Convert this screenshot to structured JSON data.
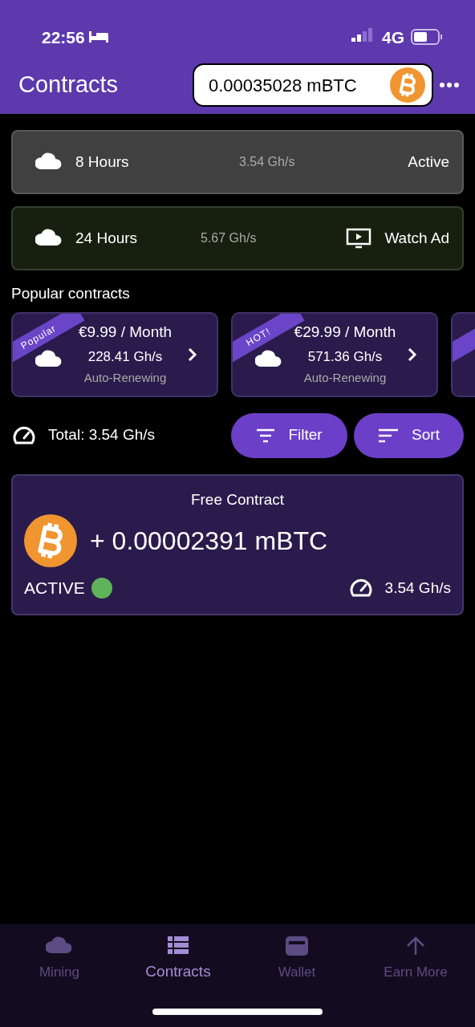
{
  "status_bar": {
    "time": "22:56",
    "network": "4G"
  },
  "header": {
    "title": "Contracts",
    "balance": "0.00035028 mBTC"
  },
  "active_contracts": [
    {
      "kind": "active",
      "duration": "8 Hours",
      "speed": "3.54 Gh/s",
      "status": "Active"
    },
    {
      "kind": "watch_ad",
      "duration": "24 Hours",
      "speed": "5.67 Gh/s",
      "status": "Watch Ad"
    }
  ],
  "popular": {
    "title": "Popular contracts",
    "items": [
      {
        "ribbon": "Popular",
        "price": "€9.99 / Month",
        "speed": "228.41 Gh/s",
        "renewal": "Auto-Renewing"
      },
      {
        "ribbon": "HOT!",
        "price": "€29.99 / Month",
        "speed": "571.36 Gh/s",
        "renewal": "Auto-Renewing"
      }
    ]
  },
  "total": "Total: 3.54 Gh/s",
  "buttons": [
    {
      "kind": "filter",
      "label": "Filter"
    },
    {
      "kind": "sort",
      "label": "Sort"
    }
  ],
  "free_contract": {
    "title": "Free Contract",
    "amount": "+ 0.00002391 mBTC",
    "status": "ACTIVE",
    "active": true,
    "speed": "3.54 Gh/s"
  },
  "tabs": [
    {
      "kind": "cloud",
      "label": "Mining",
      "selected": false
    },
    {
      "kind": "list",
      "label": "Contracts",
      "selected": true
    },
    {
      "kind": "wallet",
      "label": "Wallet",
      "selected": false
    },
    {
      "kind": "arrow",
      "label": "Earn More",
      "selected": false
    }
  ]
}
